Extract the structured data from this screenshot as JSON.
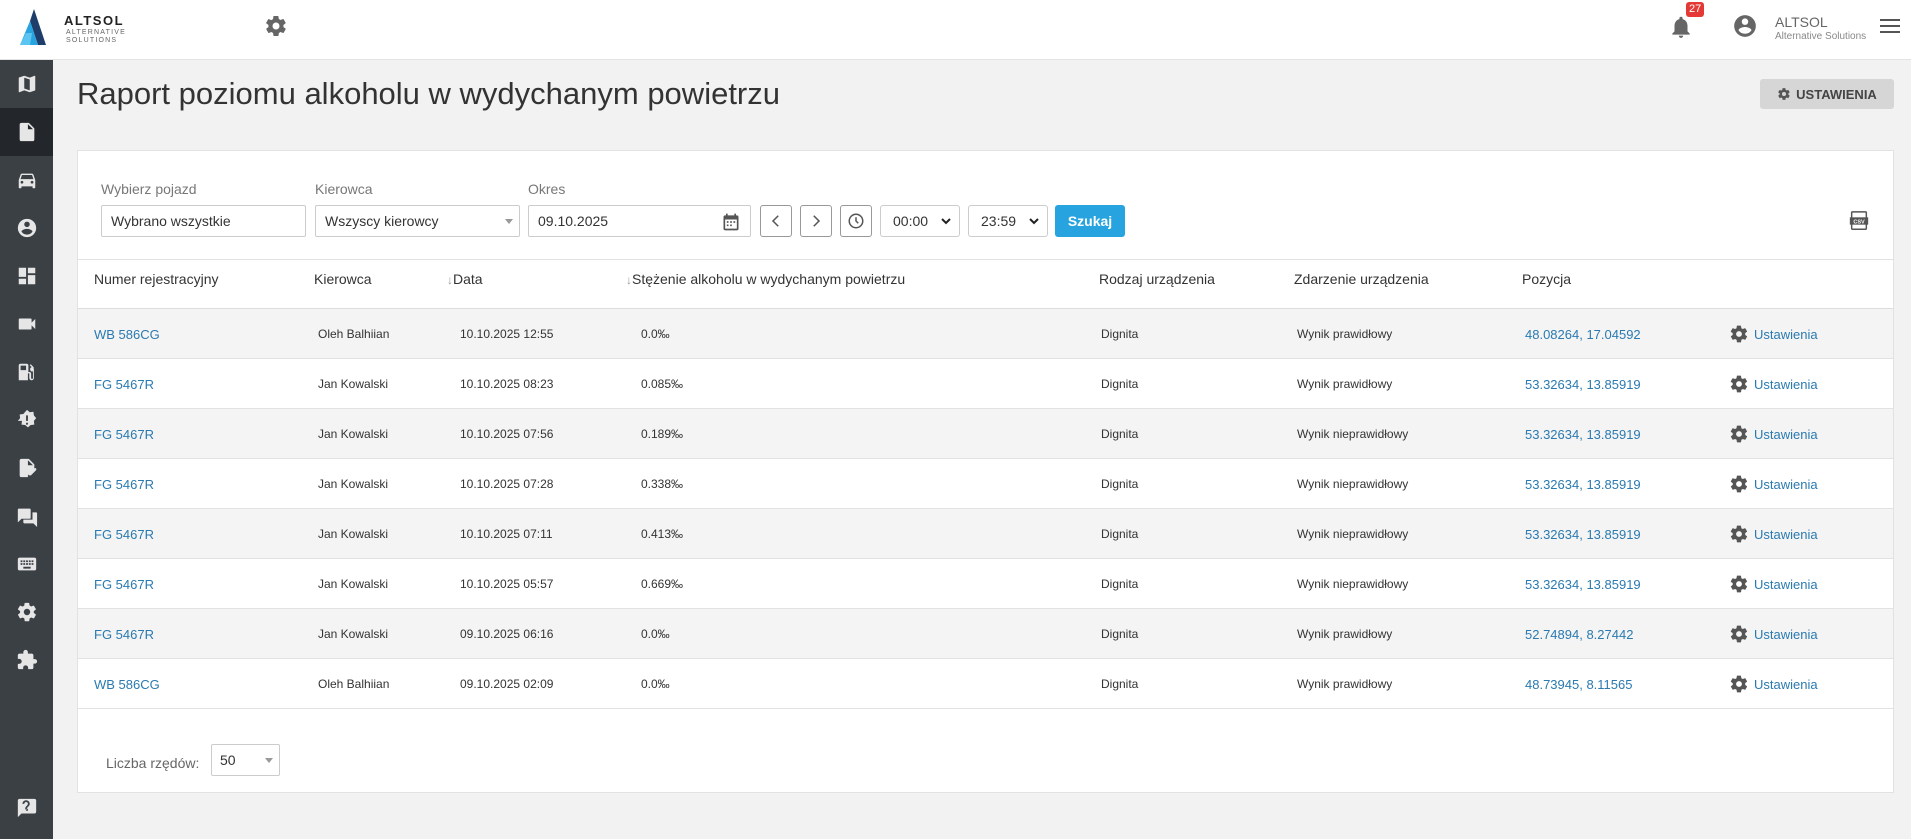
{
  "app": {
    "brand": "ALTSOL",
    "brand_sub": "ALTERNATIVE SOLUTIONS",
    "notification_count": "27",
    "user_name": "ALTSOL",
    "user_company": "Alternative Solutions",
    "accent_color": "#27a4e0",
    "sidebar_bg": "#3b4045"
  },
  "sidebar": {
    "items": [
      {
        "icon": "map-icon",
        "active": false
      },
      {
        "icon": "document-icon",
        "active": true
      },
      {
        "icon": "car-icon",
        "active": false
      },
      {
        "icon": "user-icon",
        "active": false
      },
      {
        "icon": "dashboard-icon",
        "active": false
      },
      {
        "icon": "video-icon",
        "active": false
      },
      {
        "icon": "fuel-icon",
        "active": false
      },
      {
        "icon": "alert-icon",
        "active": false
      },
      {
        "icon": "edit-icon",
        "active": false
      },
      {
        "icon": "chat-icon",
        "active": false
      },
      {
        "icon": "card-icon",
        "active": false
      },
      {
        "icon": "settings-icon",
        "active": false
      },
      {
        "icon": "plugin-icon",
        "active": false
      },
      {
        "icon": "help-icon",
        "active": false
      }
    ]
  },
  "page": {
    "title": "Raport poziomu alkoholu w wydychanym powietrzu",
    "settings_button": "USTAWIENIA"
  },
  "filters": {
    "vehicle_label": "Wybierz pojazd",
    "vehicle_value": "Wybrano wszystkie",
    "driver_label": "Kierowca",
    "driver_value": "Wszyscy kierowcy",
    "period_label": "Okres",
    "date_value": "09.10.2025",
    "time_from": "00:00",
    "time_to": "23:59",
    "search_button": "Szukaj"
  },
  "table": {
    "columns": [
      "Numer rejestracyjny",
      "Kierowca",
      "Data",
      "Stężenie alkoholu w wydychanym powietrzu",
      "Rodzaj urządzenia",
      "Zdarzenie urządzenia",
      "Pozycja"
    ],
    "sort_arrow": "↓",
    "action_label": "Ustawienia",
    "rows": [
      {
        "plate": "WB 586CG",
        "driver": "Oleh Balhiian",
        "date": "10.10.2025 12:55",
        "level": "0.0‰",
        "device": "Dignita",
        "event": "Wynik prawidłowy",
        "position": "48.08264, 17.04592"
      },
      {
        "plate": "FG 5467R",
        "driver": "Jan Kowalski",
        "date": "10.10.2025 08:23",
        "level": "0.085‰",
        "device": "Dignita",
        "event": "Wynik prawidłowy",
        "position": "53.32634, 13.85919"
      },
      {
        "plate": "FG 5467R",
        "driver": "Jan Kowalski",
        "date": "10.10.2025 07:56",
        "level": "0.189‰",
        "device": "Dignita",
        "event": "Wynik nieprawidłowy",
        "position": "53.32634, 13.85919"
      },
      {
        "plate": "FG 5467R",
        "driver": "Jan Kowalski",
        "date": "10.10.2025 07:28",
        "level": "0.338‰",
        "device": "Dignita",
        "event": "Wynik nieprawidłowy",
        "position": "53.32634, 13.85919"
      },
      {
        "plate": "FG 5467R",
        "driver": "Jan Kowalski",
        "date": "10.10.2025 07:11",
        "level": "0.413‰",
        "device": "Dignita",
        "event": "Wynik nieprawidłowy",
        "position": "53.32634, 13.85919"
      },
      {
        "plate": "FG 5467R",
        "driver": "Jan Kowalski",
        "date": "10.10.2025 05:57",
        "level": "0.669‰",
        "device": "Dignita",
        "event": "Wynik nieprawidłowy",
        "position": "53.32634, 13.85919"
      },
      {
        "plate": "FG 5467R",
        "driver": "Jan Kowalski",
        "date": "09.10.2025 06:16",
        "level": "0.0‰",
        "device": "Dignita",
        "event": "Wynik prawidłowy",
        "position": "52.74894, 8.27442"
      },
      {
        "plate": "WB 586CG",
        "driver": "Oleh Balhiian",
        "date": "09.10.2025 02:09",
        "level": "0.0‰",
        "device": "Dignita",
        "event": "Wynik prawidłowy",
        "position": "48.73945, 8.11565"
      }
    ]
  },
  "pager": {
    "label": "Liczba rzędów:",
    "value": "50"
  }
}
